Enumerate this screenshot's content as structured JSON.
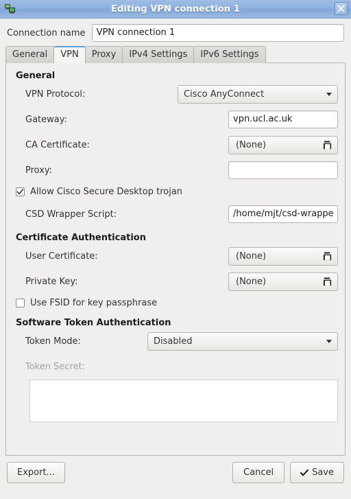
{
  "window": {
    "title": "Editing VPN connection 1",
    "icon": "network-vpn-icon",
    "close_label": "✕"
  },
  "connection": {
    "name_label": "Connection name",
    "name_value": "VPN connection 1",
    "name_placeholder": ""
  },
  "tabs": [
    {
      "label": "General",
      "active": false
    },
    {
      "label": "VPN",
      "active": true
    },
    {
      "label": "Proxy",
      "active": false
    },
    {
      "label": "IPv4 Settings",
      "active": false
    },
    {
      "label": "IPv6 Settings",
      "active": false
    }
  ],
  "vpn_page": {
    "general_section": {
      "title": "General",
      "vpn_protocol": {
        "label": "VPN Protocol:",
        "value": "Cisco AnyConnect"
      },
      "gateway": {
        "label": "Gateway:",
        "value": "vpn.ucl.ac.uk",
        "placeholder": ""
      },
      "ca_certificate": {
        "label": "CA Certificate:",
        "value": "(None)",
        "icon": "open-file-icon"
      },
      "proxy": {
        "label": "Proxy:",
        "value": "",
        "placeholder": ""
      },
      "allow_csd": {
        "label": "Allow Cisco Secure Desktop trojan",
        "checked": true
      },
      "csd_wrapper": {
        "label": "CSD Wrapper Script:",
        "value": "/home/mjt/csd-wrappe",
        "placeholder": ""
      }
    },
    "certificate_section": {
      "title": "Certificate Authentication",
      "user_certificate": {
        "label": "User Certificate:",
        "value": "(None)",
        "icon": "open-file-icon"
      },
      "private_key": {
        "label": "Private Key:",
        "value": "(None)",
        "icon": "open-file-icon"
      },
      "use_fsid": {
        "label": "Use FSID for key passphrase",
        "checked": false
      }
    },
    "token_section": {
      "title": "Software Token Authentication",
      "token_mode": {
        "label": "Token Mode:",
        "value": "Disabled"
      },
      "token_secret": {
        "label": "Token Secret:",
        "value": "",
        "disabled": true
      }
    }
  },
  "actions": {
    "export_label": "Export...",
    "cancel_label": "Cancel",
    "save_label": "Save"
  },
  "colors": {
    "titlebar_accent": "#8cb0dd",
    "active_tab_underline": "#5b9bd9",
    "window_bg": "#f0efee",
    "disabled_text": "#a5a3a0"
  }
}
